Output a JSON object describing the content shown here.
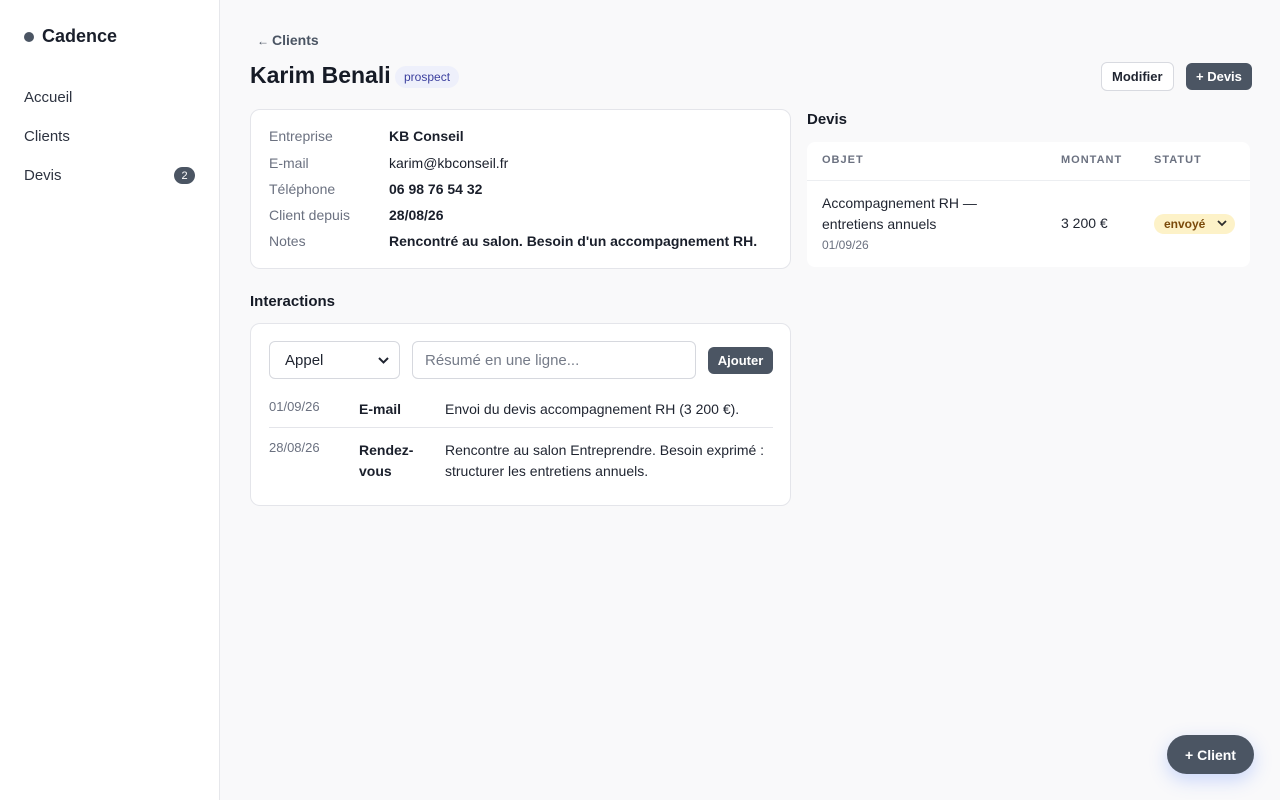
{
  "app": {
    "name": "Cadence"
  },
  "sidebar": {
    "items": [
      {
        "label": "Accueil"
      },
      {
        "label": "Clients"
      },
      {
        "label": "Devis",
        "badge": "2"
      }
    ]
  },
  "header": {
    "back_arrow": "←",
    "back_label": "Clients",
    "client_name": "Karim Benali",
    "status": "prospect",
    "modify_label": "Modifier",
    "add_quote_label": "+ Devis"
  },
  "info": {
    "rows": [
      {
        "label": "Entreprise",
        "value": "KB Conseil"
      },
      {
        "label": "E-mail",
        "value": "karim@kbconseil.fr"
      },
      {
        "label": "Téléphone",
        "value": "06 98 76 54 32"
      },
      {
        "label": "Client depuis",
        "value": "28/08/26"
      },
      {
        "label": "Notes",
        "value": "Rencontré au salon. Besoin d'un accompagnement RH."
      }
    ]
  },
  "devis": {
    "title": "Devis",
    "columns": [
      "OBJET",
      "MONTANT",
      "STATUT"
    ],
    "rows": [
      {
        "object": "Accompagnement RH — entretiens annuels",
        "date": "01/09/26",
        "amount": "3 200 €",
        "status": "envoyé"
      }
    ]
  },
  "interactions": {
    "title": "Interactions",
    "type_selected": "Appel",
    "input_placeholder": "Résumé en une ligne...",
    "add_label": "Ajouter",
    "rows": [
      {
        "date": "01/09/26",
        "kind": "E-mail",
        "text": "Envoi du devis accompagnement RH (3 200 €)."
      },
      {
        "date": "28/08/26",
        "kind": "Rendez-vous",
        "text": "Rencontre au salon Entreprendre. Besoin exprimé : structurer les entretiens annuels."
      }
    ]
  },
  "fab": {
    "label": "+ Client"
  },
  "icons": {
    "chevron": "chevron-down-icon",
    "brand_dot": "dot-icon"
  },
  "colors": {
    "primary": "#4b5563",
    "status_pill_bg": "#eef0fb",
    "status_pill_fg": "#3b3f9e",
    "sent_bg": "#fdf2c8",
    "sent_fg": "#7a4a0a"
  }
}
